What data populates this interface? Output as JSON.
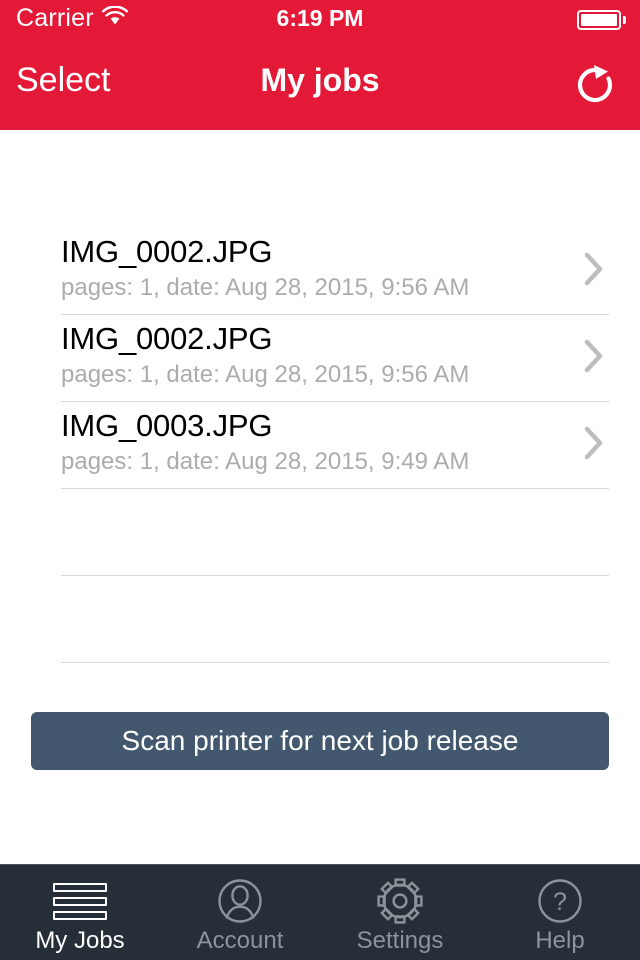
{
  "status_bar": {
    "carrier": "Carrier",
    "wifi_icon": "wifi-icon",
    "time": "6:19 PM",
    "battery_icon": "battery-full-icon"
  },
  "nav_bar": {
    "select_label": "Select",
    "title": "My jobs",
    "refresh_icon": "refresh-icon"
  },
  "jobs": [
    {
      "name": "IMG_0002.JPG",
      "meta": "pages: 1, date: Aug 28, 2015, 9:56 AM"
    },
    {
      "name": "IMG_0002.JPG",
      "meta": "pages: 1, date: Aug 28, 2015, 9:56 AM"
    },
    {
      "name": "IMG_0003.JPG",
      "meta": "pages: 1, date: Aug 28, 2015, 9:49 AM"
    }
  ],
  "empty_rows": 2,
  "scan_button": {
    "label": "Scan printer for next job release"
  },
  "tab_bar": {
    "items": [
      {
        "label": "My Jobs",
        "icon": "list-lines-icon",
        "active": true
      },
      {
        "label": "Account",
        "icon": "person-circle-icon",
        "active": false
      },
      {
        "label": "Settings",
        "icon": "gear-icon",
        "active": false
      },
      {
        "label": "Help",
        "icon": "question-circle-icon",
        "active": false
      }
    ]
  },
  "colors": {
    "brand_red": "#E31937",
    "tabbar_bg": "#262E38",
    "button_bg": "#43586E",
    "separator": "#D6D6D6",
    "subtitle_gray": "#ACACAC",
    "inactive_tab": "#8C939B"
  }
}
